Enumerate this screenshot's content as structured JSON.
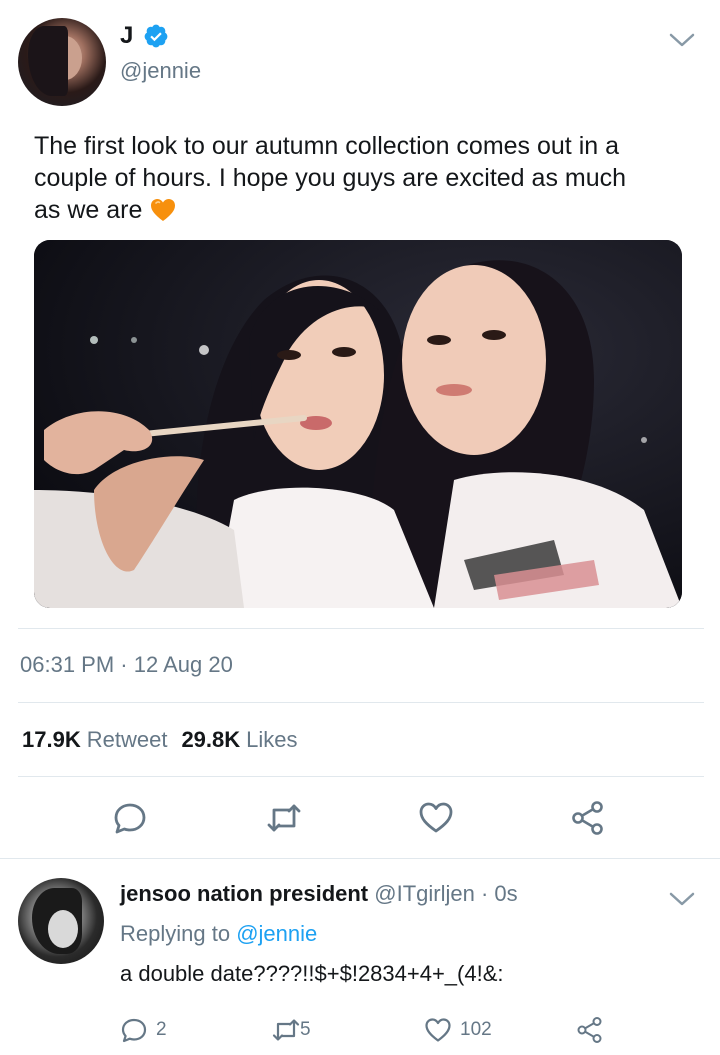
{
  "tweet": {
    "display_name": "J",
    "handle": "@jennie",
    "text": "The first look to our autumn collection comes out in a couple of hours. I hope you guys are excited as much as we are",
    "emoji": "orange-heart",
    "timestamp": "06:31 PM · 12 Aug 20",
    "retweet_count": "17.9K",
    "retweet_label": "Retweet",
    "like_count": "29.8K",
    "like_label": "Likes",
    "actions": [
      "reply-icon",
      "retweet-icon",
      "heart-icon",
      "share-icon"
    ]
  },
  "reply": {
    "display_name": "jensoo nation president",
    "handle": "@ITgirljen",
    "time": " · 0s",
    "replying_prefix": "Replying to",
    "replying_mention": "@jennie",
    "text": "a double date????!!$+$!2834+4+_(4!&:",
    "reply_count": "2",
    "retweet_count": "5",
    "like_count": "102"
  },
  "colors": {
    "verified": "#1da1f2",
    "link": "#1da1f2",
    "secondary_text": "#657786",
    "icon": "#657786",
    "divider": "#e1e8ed",
    "emoji_heart": "#f7900d"
  }
}
